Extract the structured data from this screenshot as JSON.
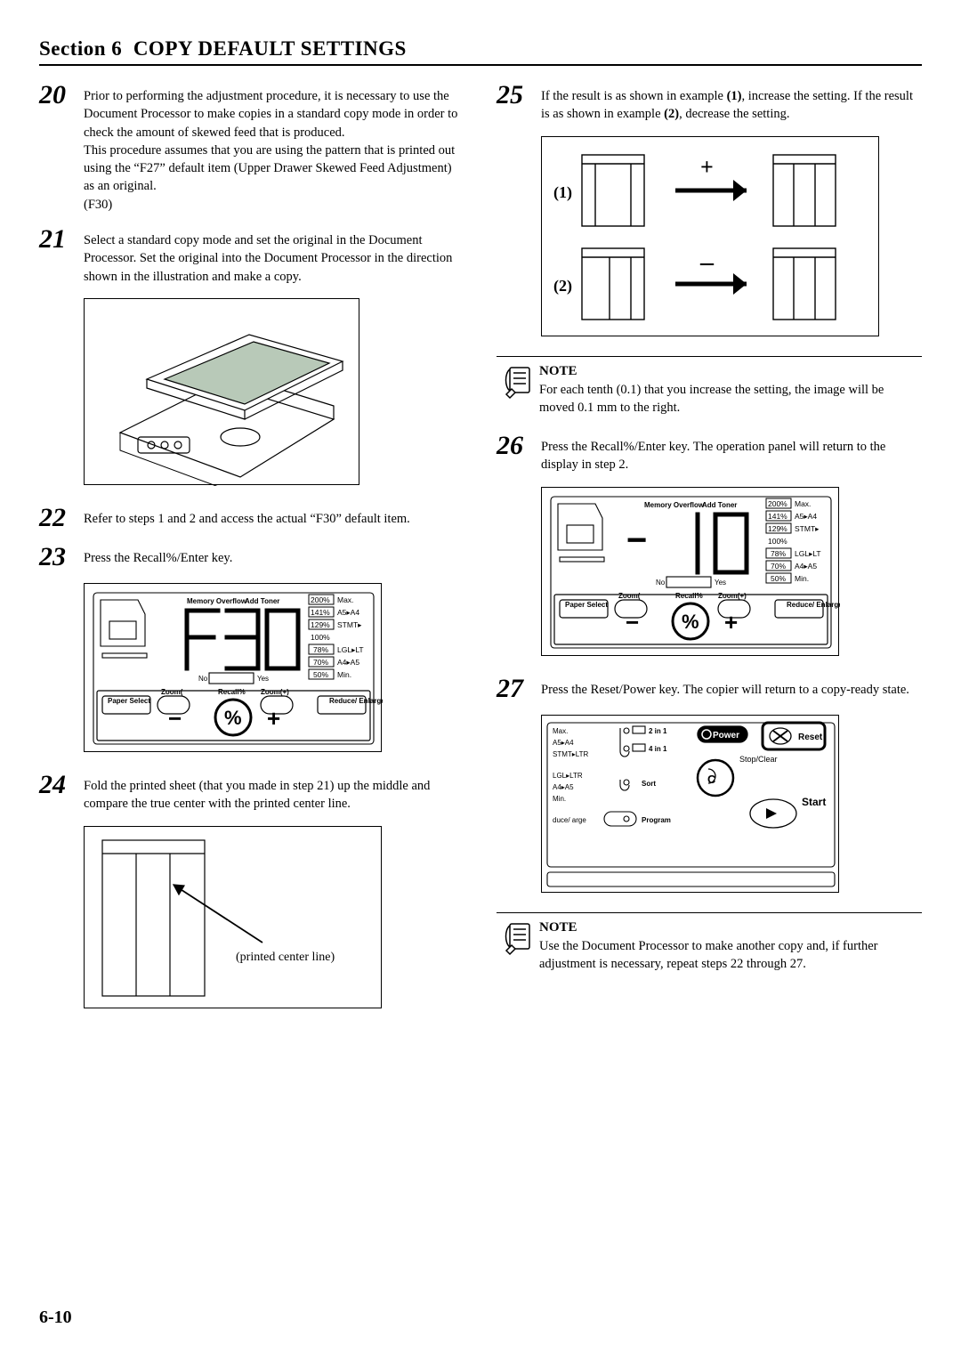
{
  "header": {
    "section": "Section 6",
    "title": "COPY DEFAULT SETTINGS"
  },
  "pageNumber": "6-10",
  "steps": {
    "s20": {
      "num": "20",
      "p1": "Prior to performing the adjustment procedure, it is necessary to use the Document Processor to make copies in a standard copy mode in order to check the amount of skewed feed that is produced.",
      "p2": "This procedure assumes that you are using the pattern that is printed out using the “F27” default item (Upper Drawer Skewed Feed Adjustment) as an original.",
      "p3": "(F30)"
    },
    "s21": {
      "num": "21",
      "p1": "Select a standard copy mode and set the original in the Document Processor. Set the original into the Document Processor in the direction shown in the illustration and make a copy."
    },
    "s22": {
      "num": "22",
      "p1": "Refer to steps 1 and 2 and access the actual “F30” default item."
    },
    "s23": {
      "num": "23",
      "p1": "Press the Recall%/Enter key."
    },
    "s24": {
      "num": "24",
      "p1": "Fold the printed sheet (that you made in step 21) up the middle and compare the true center with the printed center line."
    },
    "s25": {
      "num": "25",
      "p1_a": "If the result is as shown in example ",
      "p1_b": "(1)",
      "p1_c": ", increase the setting. If the result is as shown in example ",
      "p1_d": "(2)",
      "p1_e": ", decrease the setting."
    },
    "s26": {
      "num": "26",
      "p1": "Press the Recall%/Enter key. The operation panel will return to the display in step 2."
    },
    "s27": {
      "num": "27",
      "p1": "Press the Reset/Power key. The copier will return to a copy-ready state."
    }
  },
  "notes": {
    "n1": {
      "title": "NOTE",
      "text": "For each tenth (0.1) that you increase the setting, the image will be moved 0.1 mm to the right."
    },
    "n2": {
      "title": "NOTE",
      "text": "Use the Document Processor to make another copy and, if further adjustment is necessary, repeat steps 22 through 27."
    }
  },
  "fig": {
    "printedCenterLine": "(printed center line)",
    "ex1": "(1)",
    "ex2": "(2)",
    "plus": "+",
    "minus": "–",
    "panel": {
      "paperSelect": "Paper\nSelect",
      "zoom": "Zoom(",
      "recall": "Recall%",
      "zoomPlus": "Zoom(+)",
      "reduceEnlarge": "Reduce/\nEnlarge",
      "memoryOverflow": "Memory\nOverflow",
      "addToner": "Add\nToner",
      "no": "No",
      "yes": "Yes",
      "zoom200": "200%",
      "zoom200t": "Max.",
      "zoom141": "141%",
      "zoom141t": "A5▸A4",
      "zoom129": "129%",
      "zoom129t": "STMT▸",
      "zoom100": "100%",
      "zoom78": "78%",
      "zoom78t": "LGL▸LT",
      "zoom70": "70%",
      "zoom70t": "A4▸A5",
      "zoom50": "50%",
      "zoom50t": "Min."
    },
    "reset": {
      "max": "Max.",
      "a5a4": "A5▸A4",
      "stmtltr": "STMT▸LTR",
      "lglltr": "LGL▸LTR",
      "a4a5": "A4▸A5",
      "min": "Min.",
      "duce": "duce/\narge",
      "twoIn1": "2 in 1",
      "fourIn1": "4 in 1",
      "sort": "Sort",
      "program": "Program",
      "power": "Power",
      "reset": "Reset",
      "stopClear": "Stop/Clear",
      "start": "Start",
      "c": "C"
    }
  }
}
